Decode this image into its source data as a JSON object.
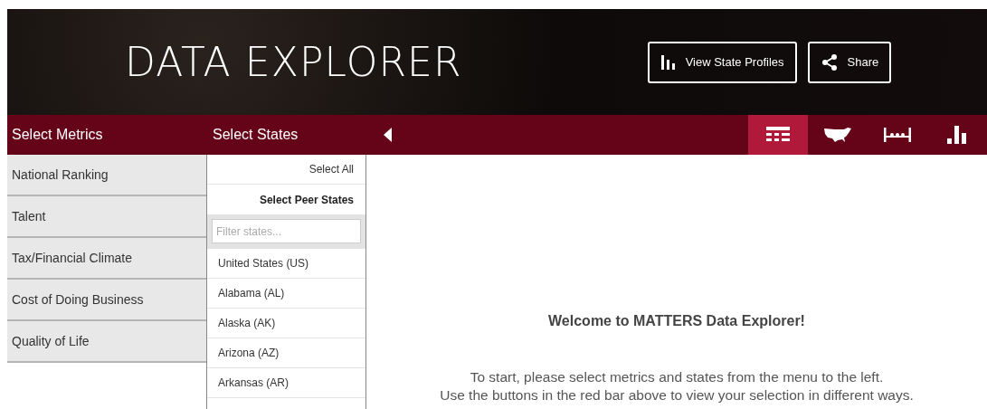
{
  "header": {
    "title": "DATA EXPLORER",
    "buttons": [
      {
        "kind": "profiles",
        "label": "View State Profiles"
      },
      {
        "kind": "share",
        "label": "Share"
      }
    ]
  },
  "toolbar": {
    "metrics_label": "Select Metrics",
    "states_label": "Select States",
    "views": [
      {
        "kind": "table",
        "selected": true
      },
      {
        "kind": "map",
        "selected": false
      },
      {
        "kind": "range",
        "selected": false
      },
      {
        "kind": "bars",
        "selected": false
      }
    ]
  },
  "metrics": [
    "National Ranking",
    "Talent",
    "Tax/Financial Climate",
    "Cost of Doing Business",
    "Quality of Life"
  ],
  "states_panel": {
    "select_all": "Select All",
    "select_peers": "Select Peer States",
    "filter_placeholder": "Filter states...",
    "states": [
      "United States (US)",
      "Alabama (AL)",
      "Alaska (AK)",
      "Arizona (AZ)",
      "Arkansas (AR)"
    ]
  },
  "welcome": {
    "heading": "Welcome to MATTERS Data Explorer!",
    "lines": [
      "To start, please select metrics and states from the menu to the left.",
      "Use the buttons in the red bar above to view your selection in different ways."
    ]
  }
}
